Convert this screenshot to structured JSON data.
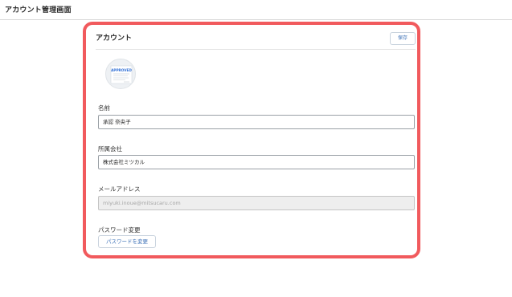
{
  "header": {
    "title": "アカウント管理画面"
  },
  "card": {
    "title": "アカウント",
    "save_label": "保存",
    "avatar": {
      "stamp_text": "APPROVED",
      "icon": "approved-stamp-image"
    }
  },
  "fields": {
    "name": {
      "label": "名前",
      "value": "承認 奈央子"
    },
    "company": {
      "label": "所属会社",
      "value": "株式会社ミツカル"
    },
    "email": {
      "label": "メールアドレス",
      "value": "miyuki.inoue@mitsucaru.com",
      "disabled": true
    },
    "password": {
      "label": "パスワード変更",
      "button_label": "パスワードを変更"
    }
  },
  "colors": {
    "highlight": "#f15a5d",
    "link_blue": "#3a6fb6",
    "stamp_blue": "#2f6fd6"
  }
}
